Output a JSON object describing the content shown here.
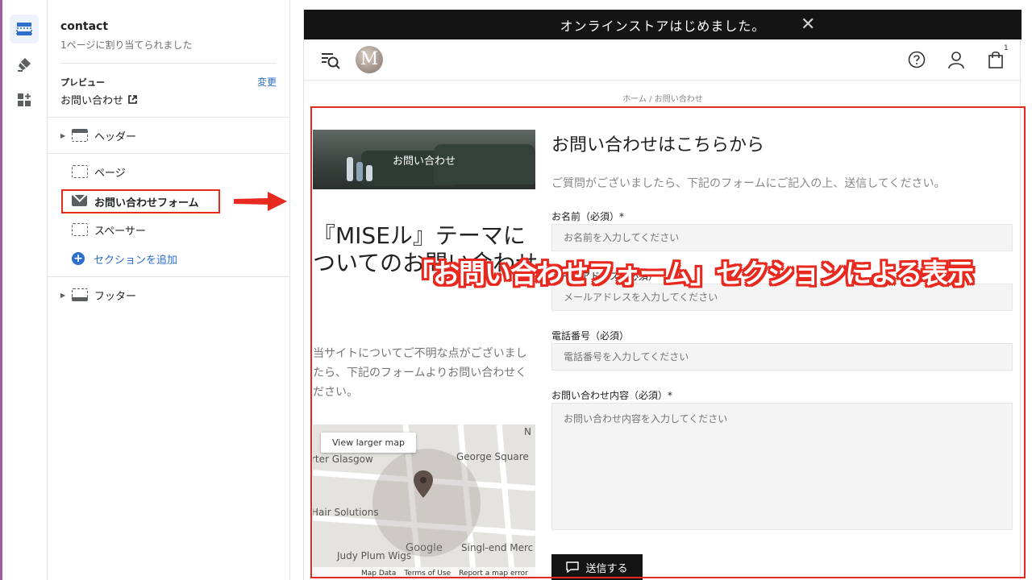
{
  "editor": {
    "page_title": "contact",
    "page_subtitle": "1ページに割り当てられました",
    "preview_label": "プレビュー",
    "change_link": "変更",
    "preview_page": "お問い合わせ",
    "sections": [
      {
        "label": "ヘッダー",
        "icon": "header-section-icon"
      },
      {
        "label": "ページ",
        "icon": "section-icon"
      },
      {
        "label": "お問い合わせフォーム",
        "icon": "mail-icon",
        "highlighted": true
      },
      {
        "label": "スペーサー",
        "icon": "section-icon"
      },
      {
        "label": "セクションを追加",
        "icon": "plus-circle-icon"
      },
      {
        "label": "フッター",
        "icon": "footer-section-icon"
      }
    ]
  },
  "store": {
    "announcement": "オンラインストアはじめました。",
    "close_glyph": "✕",
    "logo_letter": "M",
    "cart_count": "1",
    "breadcrumb": "ホーム  /  お問い合わせ",
    "banner_text": "お問い合わせ",
    "big_title": "『MISEル』テーマについてのお問い合わせ",
    "left_description": "当サイトについてご不明な点がございましたら、下記のフォームよりお問い合わせください。",
    "map": {
      "larger_map": "View larger map",
      "labels": [
        "rter Glasgow",
        "George Square",
        "Hair Solutions",
        "Singl-end Merc",
        "Judy Plum Wigs",
        "N"
      ],
      "google": "Google",
      "attribution": [
        "Map Data",
        "Terms of Use",
        "Report a map error"
      ]
    },
    "form": {
      "title": "お問い合わせはこちらから",
      "description": "ご質問がございましたら、下記のフォームにご記入の上、送信してください。",
      "name_label": "お名前（必須）*",
      "name_placeholder": "お名前を入力してください",
      "email_label": "メールアドレス（必須）*",
      "email_placeholder": "メールアドレスを入力してください",
      "phone_label": "電話番号（必須）",
      "phone_placeholder": "電話番号を入力してください",
      "message_label": "お問い合わせ内容（必須）*",
      "message_placeholder": "お問い合わせ内容を入力してください",
      "submit_label": "送信する"
    }
  },
  "annotation": {
    "text": "「お問い合わせフォーム」セクションによる表示",
    "color": "#e8291f"
  }
}
